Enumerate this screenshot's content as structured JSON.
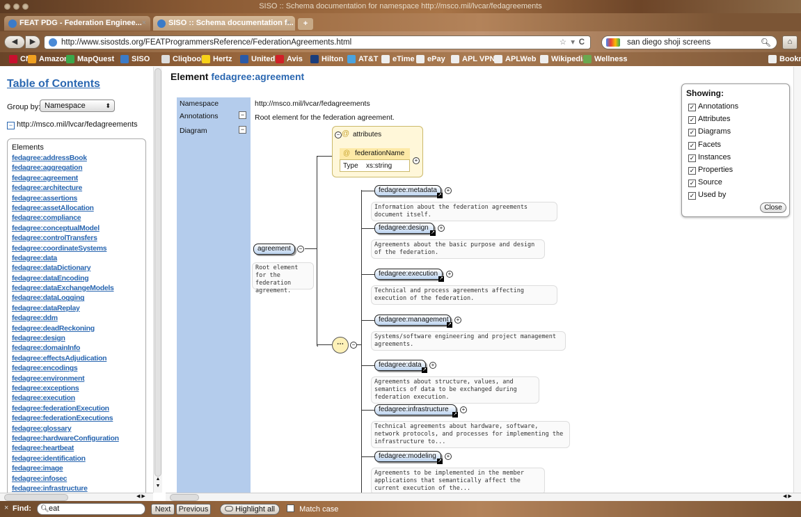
{
  "window": {
    "title": "SISO :: Schema documentation for namespace http://msco.mil/lvcar/fedagreements"
  },
  "tabs": [
    {
      "label": "FEAT PDG - Federation Enginee...",
      "close": "×"
    },
    {
      "label": "SISO :: Schema documentation f...",
      "close": "×"
    }
  ],
  "new_tab": "+",
  "nav": {
    "back": "◀",
    "forward": "▶",
    "url": "http://www.sisostds.org/FEATProgrammersReference/FederationAgreements.html",
    "star": "☆",
    "dropdown": "▾",
    "reload": "C",
    "search_value": "san diego shoji screens",
    "search_icon": "magnifier-icon",
    "home_icon": "house-icon"
  },
  "bookmarks": [
    {
      "label": "CNN",
      "color": "#c8102e"
    },
    {
      "label": "Amazon",
      "color": "#f0a020"
    },
    {
      "label": "MapQuest",
      "color": "#3aa84a"
    },
    {
      "label": "SISO",
      "color": "#3b7bc8"
    },
    {
      "label": "Cliqbook",
      "color": "#dddddd"
    },
    {
      "label": "Hertz",
      "color": "#f7d117"
    },
    {
      "label": "United",
      "color": "#2a5aa8"
    },
    {
      "label": "Avis",
      "color": "#d12027"
    },
    {
      "label": "Hilton",
      "color": "#1a3d7c"
    },
    {
      "label": "AT&T",
      "color": "#4aa3df"
    },
    {
      "label": "eTime",
      "color": "#eeeeee"
    },
    {
      "label": "ePay",
      "color": "#eeeeee"
    },
    {
      "label": "APL VPN",
      "color": "#eeeeee"
    },
    {
      "label": "APLWeb",
      "color": "#eeeeee"
    },
    {
      "label": "Wikipedia",
      "color": "#eeeeee"
    },
    {
      "label": "Wellness",
      "color": "#6aa84f"
    },
    {
      "label": "Bookmarks",
      "color": "#eeeeee"
    }
  ],
  "toc": {
    "title": "Table of Contents",
    "group_by_label": "Group by:",
    "group_by_value": "Namespace",
    "group_by_arrow": "⬍",
    "namespace_toggle": "−",
    "namespace": "http://msco.mil/lvcar/fedagreements",
    "elements_title": "Elements",
    "elements": [
      "fedagree:addressBook",
      "fedagree:aggregation",
      "fedagree:agreement",
      "fedagree:architecture",
      "fedagree:assertions",
      "fedagree:assetAllocation",
      "fedagree:compliance",
      "fedagree:conceptualModel",
      "fedagree:controlTransfers",
      "fedagree:coordinateSystems",
      "fedagree:data",
      "fedagree:dataDictionary",
      "fedagree:dataEncoding",
      "fedagree:dataExchangeModels",
      "fedagree:dataLogging",
      "fedagree:dataReplay",
      "fedagree:ddm",
      "fedagree:deadReckoning",
      "fedagree:design",
      "fedagree:domainInfo",
      "fedagree:effectsAdjudication",
      "fedagree:encodings",
      "fedagree:environment",
      "fedagree:exceptions",
      "fedagree:execution",
      "fedagree:federationExecution",
      "fedagree:federationExecutions",
      "fedagree:glossary",
      "fedagree:hardwareConfiguration",
      "fedagree:heartbeat",
      "fedagree:identification",
      "fedagree:image",
      "fedagree:infosec",
      "fedagree:infrastructure"
    ]
  },
  "element": {
    "title_prefix": "Element",
    "title_name": "fedagree:agreement",
    "namespace_label": "Namespace",
    "namespace_value": "http://msco.mil/lvcar/fedagreements",
    "annotations_label": "Annotations",
    "annotations_value": "Root element for the federation agreement.",
    "diagram_label": "Diagram",
    "toggle": "−"
  },
  "diagram": {
    "root": {
      "name": "agreement",
      "note": "Root element for the federation agreement."
    },
    "attributes_title": "attributes",
    "attribute": {
      "name": "federationName",
      "type_label": "Type",
      "type_value": "xs:string"
    },
    "sequence_icon": "sequence-icon",
    "plus": "+",
    "jump": "↗",
    "children": [
      {
        "name": "fedagree:metadata",
        "note": "Information about the federation agreements document itself."
      },
      {
        "name": "fedagree:design",
        "note": "Agreements about the basic purpose and design of the federation."
      },
      {
        "name": "fedagree:execution",
        "note": "Technical and process agreements affecting execution of the federation."
      },
      {
        "name": "fedagree:management",
        "note": "Systems/software engineering and project management agreements."
      },
      {
        "name": "fedagree:data",
        "note": "Agreements about structure, values, and semantics of data to be exchanged during federation execution."
      },
      {
        "name": "fedagree:infrastructure",
        "note": "Technical agreements about hardware, software, network protocols, and processes for implementing the infrastructure to..."
      },
      {
        "name": "fedagree:modeling",
        "note": "Agreements to be implemented in the member applications that semantically affect the current execution of the..."
      }
    ]
  },
  "showing": {
    "title": "Showing:",
    "check": "✓",
    "options": [
      "Annotations",
      "Attributes",
      "Diagrams",
      "Facets",
      "Instances",
      "Properties",
      "Source",
      "Used by"
    ],
    "close": "Close"
  },
  "findbar": {
    "close": "×",
    "label": "Find:",
    "value": "eat",
    "next": "Next",
    "previous": "Previous",
    "highlight_all": "Highlight all",
    "match_case": "Match case"
  },
  "colors": {
    "link": "#2a67b1",
    "props_column": "#b4ccec",
    "node_fill": "#bcd3ef"
  }
}
